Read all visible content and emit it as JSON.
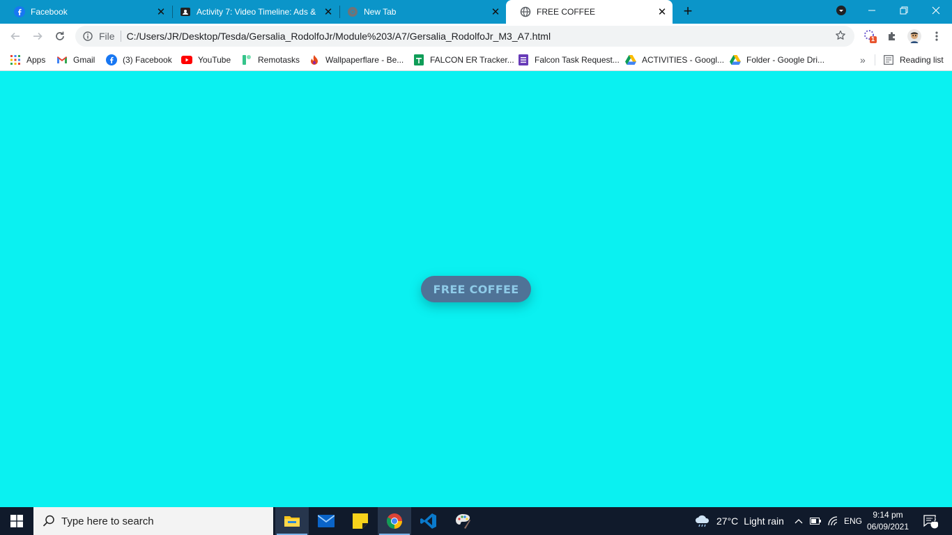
{
  "tabs": [
    {
      "title": "Facebook",
      "icon": "facebook-icon",
      "active": false
    },
    {
      "title": "Activity 7: Video Timeline: Ads &",
      "icon": "classroom-icon",
      "active": false
    },
    {
      "title": "New Tab",
      "icon": "chrome-icon",
      "active": false
    },
    {
      "title": "FREE COFFEE",
      "icon": "globe-icon",
      "active": true
    }
  ],
  "omnibox": {
    "scheme_label": "File",
    "url": "C:/Users/JR/Desktop/Tesda/Gersalia_RodolfoJr/Module%203/A7/Gersalia_RodolfoJr_M3_A7.html"
  },
  "extensions": {
    "badge_count": "1"
  },
  "bookmarks": [
    {
      "label": "Apps",
      "icon": "apps-grid-icon"
    },
    {
      "label": "Gmail",
      "icon": "gmail-icon"
    },
    {
      "label": "(3) Facebook",
      "icon": "facebook-icon"
    },
    {
      "label": "YouTube",
      "icon": "youtube-icon"
    },
    {
      "label": "Remotasks",
      "icon": "remotasks-icon"
    },
    {
      "label": "Wallpaperflare - Be...",
      "icon": "wallpaperflare-icon"
    },
    {
      "label": "FALCON ER Tracker...",
      "icon": "sheets-icon"
    },
    {
      "label": "Falcon Task Request...",
      "icon": "forms-icon"
    },
    {
      "label": "ACTIVITIES - Googl...",
      "icon": "drive-icon"
    },
    {
      "label": "Folder - Google Dri...",
      "icon": "drive-icon"
    }
  ],
  "reading_list_label": "Reading list",
  "page": {
    "background": "#0af1f1",
    "button_label": "FREE COFFEE",
    "button_color": "#4f7397",
    "button_text_color": "#8ecbe8"
  },
  "taskbar": {
    "search_placeholder": "Type here to search",
    "weather_temp": "27°C",
    "weather_desc": "Light rain",
    "language": "ENG",
    "time": "9:14 pm",
    "date": "06/09/2021",
    "notification_count": "12"
  }
}
